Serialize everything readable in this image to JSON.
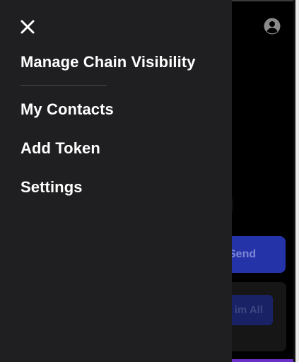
{
  "drawer": {
    "close_icon": "close-icon",
    "items": [
      {
        "label": "Manage Chain Visibility"
      },
      {
        "label": "My Contacts"
      },
      {
        "label": "Add Token"
      },
      {
        "label": "Settings"
      }
    ]
  },
  "background": {
    "account_icon": "account-circle-icon",
    "send_label": "Send",
    "claim_label": "im All"
  },
  "colors": {
    "drawer_bg": "#1f1f21",
    "app_bg": "#000000",
    "send_button": "#2434a8",
    "claim_button": "#1a2266",
    "text": "#ffffff"
  }
}
